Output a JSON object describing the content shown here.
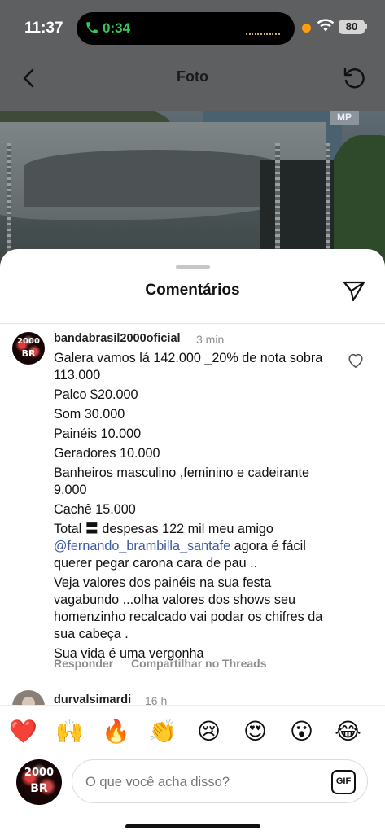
{
  "status_bar": {
    "time": "11:37",
    "call_timer": "0:34",
    "battery": "80"
  },
  "header": {
    "title": "Foto"
  },
  "photo": {
    "watermark": "MP"
  },
  "sheet": {
    "title": "Comentários"
  },
  "comments": [
    {
      "username": "bandabrasil2000oficial",
      "time": "3 min",
      "paragraphs": [
        "Galera vamos lá 142.000 _20% de nota sobra 113.000",
        "Palco $20.000",
        "Som 30.000",
        "Painéis 10.000",
        "Geradores 10.000",
        "Banheiros masculino ,feminino e cadeirante 9.000",
        "Cachê 15.000"
      ],
      "total_prefix": "Total 〓 despesas 122 mil meu amigo ",
      "mention": "@fernando_brambilla_santafe",
      "total_suffix": " agora é fácil querer pegar carona cara de pau ..",
      "paragraphs_after": [
        "Veja valores dos painéis na sua festa vagabundo ...olha valores dos shows seu homenzinho recalcado vai podar os chifres da sua cabeça .",
        "Sua vida é uma vergonha"
      ],
      "actions": {
        "reply": "Responder",
        "share": "Compartilhar no Threads"
      }
    },
    {
      "username": "durvalsimardi",
      "time": "16 h"
    }
  ],
  "reactions": [
    "❤️",
    "🙌",
    "🔥",
    "👏",
    "😢",
    "😍",
    "😮",
    "😂"
  ],
  "composer": {
    "placeholder": "O que você acha disso?",
    "gif_label": "GIF"
  },
  "avatar_text": {
    "top": "2000",
    "bottom": "BR"
  }
}
